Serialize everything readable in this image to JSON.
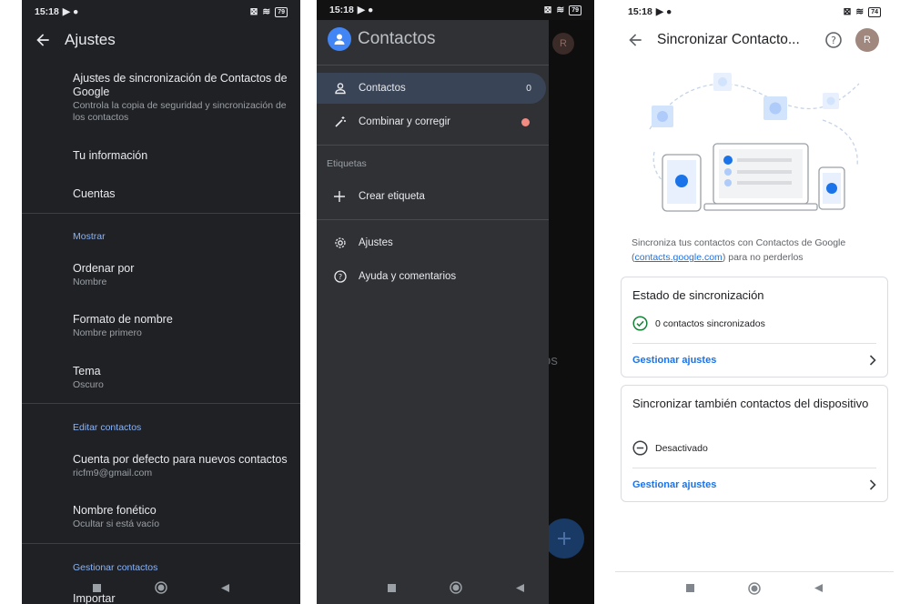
{
  "status_bars": [
    {
      "time": "15:18",
      "battery": "79"
    },
    {
      "time": "15:18",
      "battery": "79"
    },
    {
      "time": "15:18",
      "battery": "74"
    }
  ],
  "settings_screen": {
    "title": "Ajustes",
    "sync_title": "Ajustes de sincronización de Contactos de Google",
    "sync_subtitle": "Controla la copia de seguridad y sincronización de los contactos",
    "your_info": "Tu información",
    "accounts": "Cuentas",
    "display_section": "Mostrar",
    "sort_by": {
      "title": "Ordenar por",
      "value": "Nombre"
    },
    "name_format": {
      "title": "Formato de nombre",
      "value": "Nombre primero"
    },
    "theme": {
      "title": "Tema",
      "value": "Oscuro"
    },
    "edit_section": "Editar contactos",
    "default_account": {
      "title": "Cuenta por defecto para nuevos contactos",
      "value": "ricfm9@gmail.com"
    },
    "phonetic_name": {
      "title": "Nombre fonético",
      "value": "Ocultar si está vacío"
    },
    "manage_section": "Gestionar contactos",
    "import": "Importar"
  },
  "drawer_screen": {
    "app_title": "Contactos",
    "items": [
      {
        "label": "Contactos",
        "count": "0"
      },
      {
        "label": "Combinar y corregir"
      }
    ],
    "labels_section": "Etiquetas",
    "create_label": "Crear etiqueta",
    "settings": "Ajustes",
    "help": "Ayuda y comentarios",
    "avatar_letter": "R",
    "background_text": "os"
  },
  "sync_screen": {
    "title": "Sincronizar Contacto...",
    "avatar_letter": "R",
    "description_before": "Sincroniza tus contactos con Contactos de Google (",
    "description_link": "contacts.google.com",
    "description_after": ") para no perderlos",
    "card1": {
      "title": "Estado de sincronización",
      "status": "0 contactos sincronizados",
      "link": "Gestionar ajustes"
    },
    "card2": {
      "title": "Sincronizar también contactos del dispositivo",
      "status": "Desactivado",
      "link": "Gestionar ajustes"
    }
  },
  "colors": {
    "accent_dark": "#8ab4f8",
    "accent_light": "#1a73e8",
    "success": "#188038",
    "alert_dot": "#f28b82"
  }
}
